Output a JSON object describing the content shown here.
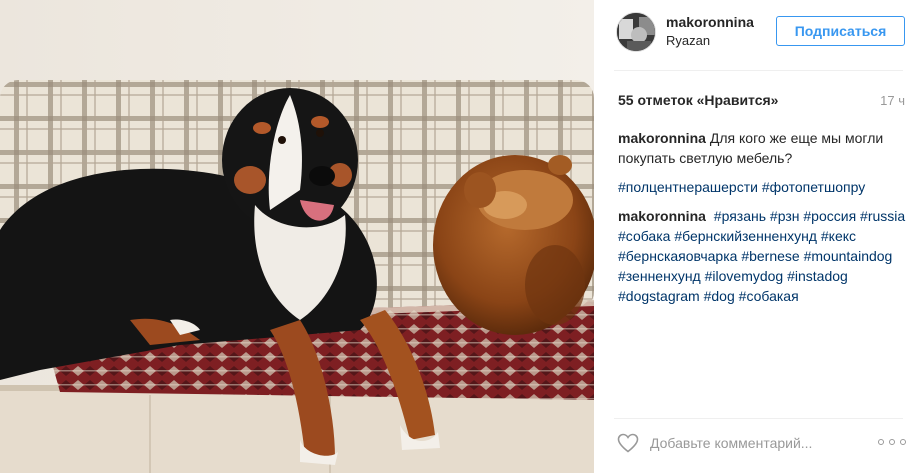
{
  "post": {
    "username": "makoronnina",
    "location": "Ryazan",
    "follow_label": "Подписаться",
    "likes_text": "55 отметок «Нравится»",
    "time_ago": "17 ч",
    "caption": {
      "author": "makoronnina",
      "text": "Для кого же еще мы могли покупать светлую мебель?",
      "hashtags": [
        "#полцентнерашерсти",
        "#фотопетшопру"
      ]
    },
    "comment": {
      "author": "makoronnina",
      "hashtags": [
        "#рязань",
        "#рзн",
        "#россия",
        "#russia",
        "#собака",
        "#бернскийзенненхунд",
        "#кекс",
        "#бернскаяовчарка",
        "#bernese",
        "#mountaindog",
        "#зенненхунд",
        "#ilovemydog",
        "#instadog",
        "#dogstagram",
        "#dog",
        "#собакая"
      ]
    },
    "add_comment_placeholder": "Добавьте комментарий..."
  },
  "icons": {
    "like": "heart-outline-icon",
    "more": "more-options-icon"
  },
  "colors": {
    "accent": "#3897f0",
    "hashtag": "#003569",
    "muted": "#999999",
    "text": "#262626"
  }
}
